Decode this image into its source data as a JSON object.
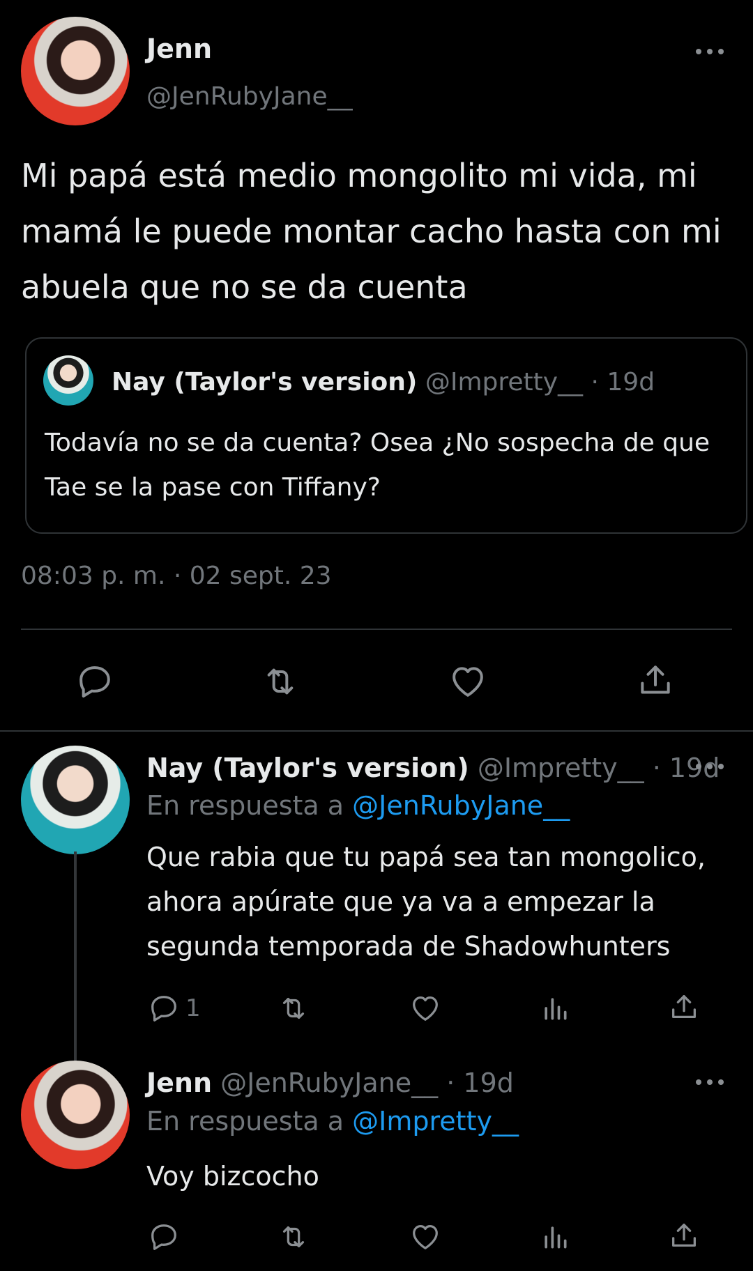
{
  "main_tweet": {
    "author_name": "Jenn",
    "author_handle": "@JenRubyJane__",
    "text": "Mi papá está medio mongolito mi vida, mi mamá le puede montar cacho hasta con mi abuela que no se da cuenta",
    "timestamp": "08:03 p. m. · 02 sept. 23",
    "quoted": {
      "author_name": "Nay (Taylor's version)",
      "author_handle": "@Impretty__",
      "age": "· 19d",
      "text": "Todavía no se da cuenta? Osea ¿No sospecha de que Tae se la pase con Tiffany?"
    },
    "actions": [
      "reply-icon",
      "retweet-icon",
      "like-icon",
      "share-icon"
    ]
  },
  "replies": [
    {
      "author_name": "Nay (Taylor's version)",
      "author_handle": "@Impretty__",
      "age": "· 19d",
      "reply_prefix": "En respuesta a",
      "reply_to": "@JenRubyJane__",
      "text": "Que rabia que tu papá sea tan mongolico, ahora apúrate que ya va a empezar la segunda temporada de Shadowhunters",
      "reply_count": "1"
    },
    {
      "author_name": "Jenn",
      "author_handle": "@JenRubyJane__",
      "age": "· 19d",
      "reply_prefix": "En respuesta a",
      "reply_to": "@Impretty__",
      "text": "Voy bizcocho",
      "reply_count": ""
    }
  ],
  "colors": {
    "background": "#000000",
    "text": "#e7e9ea",
    "secondary": "#71767b",
    "link": "#1d9bf0",
    "divider": "#2f3336"
  }
}
